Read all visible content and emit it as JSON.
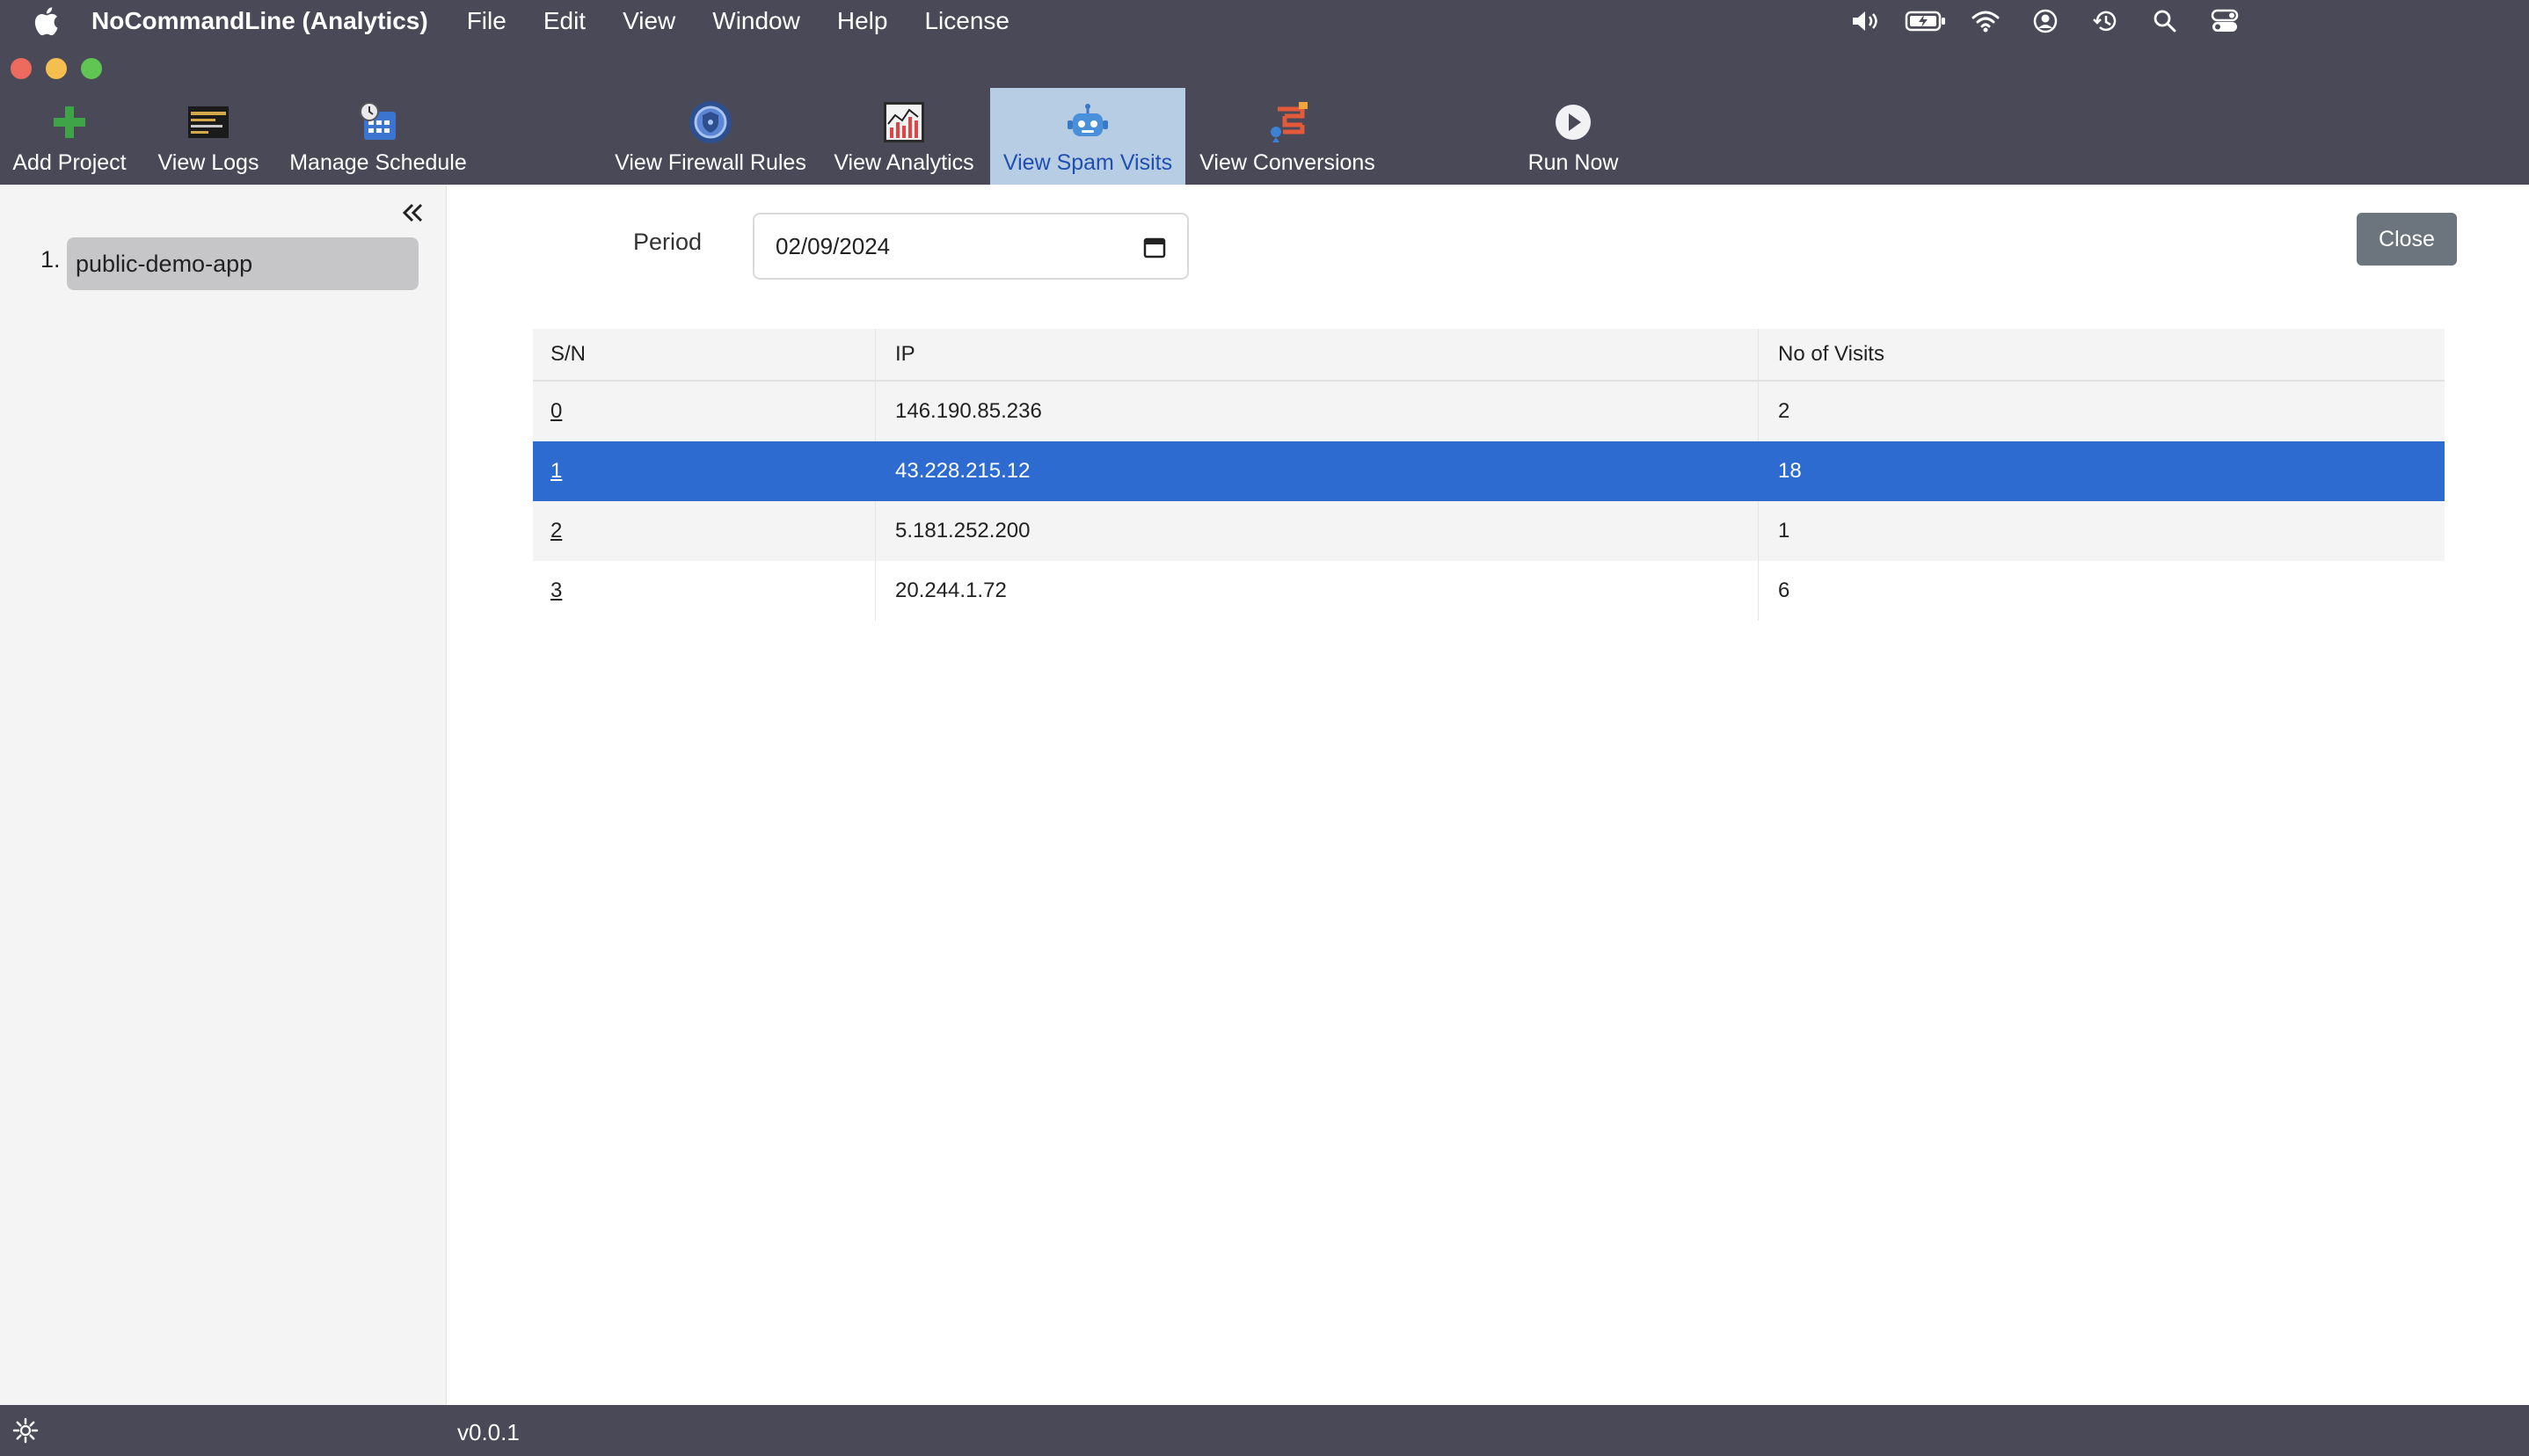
{
  "menubar": {
    "app_name": "NoCommandLine (Analytics)",
    "items": [
      "File",
      "Edit",
      "View",
      "Window",
      "Help",
      "License"
    ],
    "status_icons": [
      "volume-icon",
      "battery-icon",
      "wifi-icon",
      "user-icon",
      "time-machine-icon",
      "spotlight-icon",
      "control-center-icon"
    ]
  },
  "toolbar": {
    "add_project": "Add Project",
    "view_logs": "View Logs",
    "manage_schedule": "Manage Schedule",
    "view_firewall_rules": "View Firewall Rules",
    "view_analytics": "View Analytics",
    "view_spam_visits": "View Spam Visits",
    "view_conversions": "View Conversions",
    "run_now": "Run Now",
    "active": "View Spam Visits"
  },
  "sidebar": {
    "projects": [
      {
        "number": "1.",
        "name": "public-demo-app"
      }
    ]
  },
  "main": {
    "period_label": "Period",
    "period_value": "02/09/2024",
    "close_label": "Close",
    "table": {
      "headers": [
        "S/N",
        "IP",
        "No of Visits"
      ],
      "rows": [
        {
          "sn": "0",
          "ip": "146.190.85.236",
          "visits": "2"
        },
        {
          "sn": "1",
          "ip": "43.228.215.12",
          "visits": "18"
        },
        {
          "sn": "2",
          "ip": "5.181.252.200",
          "visits": "1"
        },
        {
          "sn": "3",
          "ip": "20.244.1.72",
          "visits": "6"
        }
      ],
      "selected_row": 1
    }
  },
  "statusbar": {
    "version": "v0.0.1"
  },
  "colors": {
    "chrome": "#4a4958",
    "active_tab": "#b7cde3",
    "selected_row": "#2d6bd1",
    "close_button": "#6c757d"
  }
}
